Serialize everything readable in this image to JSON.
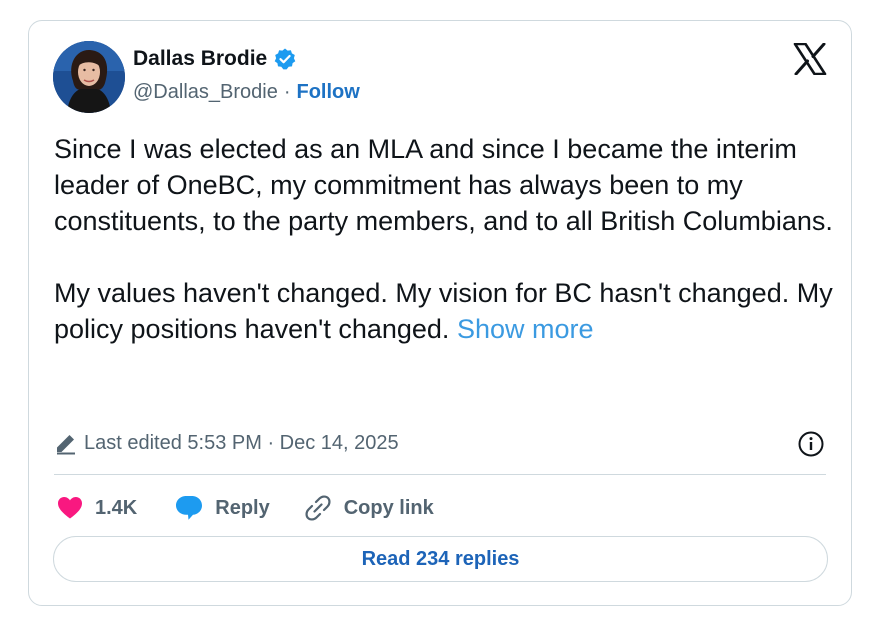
{
  "author": {
    "name": "Dallas Brodie",
    "handle": "@Dallas_Brodie",
    "separator": "·",
    "follow_label": "Follow",
    "verified": true,
    "verified_color": "#1d9bf0"
  },
  "tweet": {
    "paragraph1": "Since I was elected as an MLA and since I became the interim leader of OneBC, my commitment has always been to my constituents, to the party members, and to all British Columbians.",
    "paragraph2": "My values haven't changed. My vision for BC hasn't changed. My policy positions haven't changed.",
    "show_more_label": "Show more"
  },
  "meta": {
    "edited_text": "Last edited 5:53 PM · Dec 14, 2025"
  },
  "actions": {
    "likes_count": "1.4K",
    "reply_label": "Reply",
    "copy_link_label": "Copy link"
  },
  "footer": {
    "read_replies_label": "Read 234 replies"
  },
  "icons": {
    "platform_logo": "x-logo-icon",
    "verified": "verified-badge-icon",
    "edit": "pencil-icon",
    "info": "info-icon",
    "like": "heart-icon",
    "reply": "speech-bubble-icon",
    "copy_link": "link-icon"
  },
  "colors": {
    "link_blue": "#1d72c4",
    "show_more_blue": "#3b9ae1",
    "heart_pink": "#f91880",
    "reply_blue": "#1d9bf0",
    "muted_text": "#536471",
    "border": "#cfd9de"
  }
}
